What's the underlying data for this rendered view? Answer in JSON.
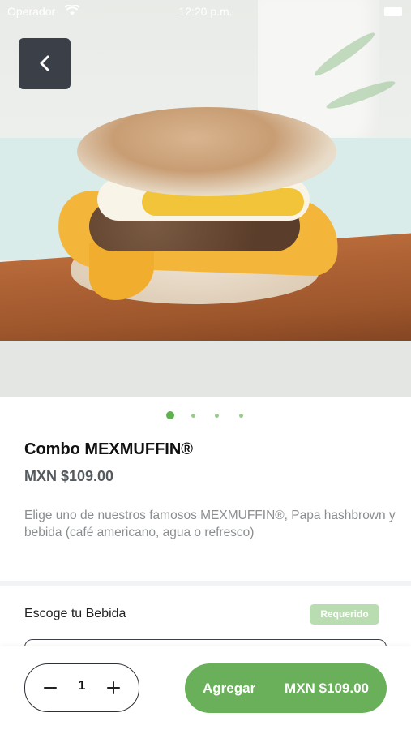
{
  "status_bar": {
    "carrier": "Operador",
    "time": "12:20 p.m."
  },
  "carousel": {
    "count": 4,
    "active_index": 0
  },
  "product": {
    "title": "Combo MEXMUFFIN®",
    "price": "MXN $109.00",
    "description": "Elige uno de nuestros famosos MEXMUFFIN®, Papa hashbrown y bebida (café americano, agua o refresco)"
  },
  "options": {
    "section_label": "Escoge tu Bebida",
    "required_badge": "Requerido"
  },
  "cart": {
    "quantity": "1",
    "add_label": "Agregar",
    "add_amount": "MXN $109.00"
  },
  "colors": {
    "accent_green": "#6ab05b",
    "badge_green": "#b9ddb0",
    "dark": "#3b4048"
  },
  "icons": {
    "back": "chevron-left-icon",
    "minus": "minus-icon",
    "plus": "plus-icon",
    "wifi": "wifi-icon",
    "battery": "battery-icon"
  }
}
